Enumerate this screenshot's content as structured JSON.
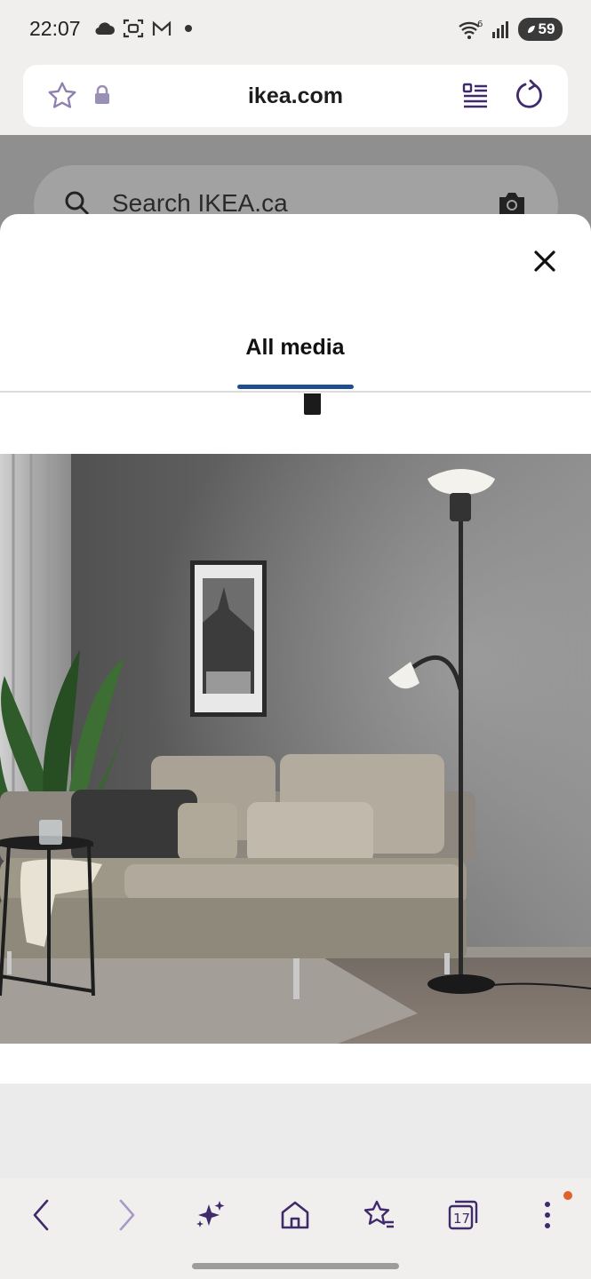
{
  "status_bar": {
    "time": "22:07",
    "left_icons": [
      "cloud-icon",
      "face-scan-icon",
      "gmail-icon",
      "dot-icon"
    ],
    "wifi_badge": "6",
    "battery_level": "59"
  },
  "browser": {
    "url": "ikea.com",
    "icons": [
      "star-outline-icon",
      "lock-icon",
      "reader-mode-icon",
      "reload-icon"
    ]
  },
  "page": {
    "search_placeholder": "Search IKEA.ca"
  },
  "modal": {
    "tab_label": "All media",
    "image_alt": "Sofa with cushions and floor lamp in living room"
  },
  "toolbar": {
    "tab_count": "17",
    "icons": [
      "back-icon",
      "forward-icon",
      "ai-sparkle-icon",
      "home-icon",
      "bookmarks-icon",
      "tabs-icon",
      "more-menu-icon"
    ],
    "accent": "#3f2a6b",
    "notification_color": "#e0622b"
  }
}
